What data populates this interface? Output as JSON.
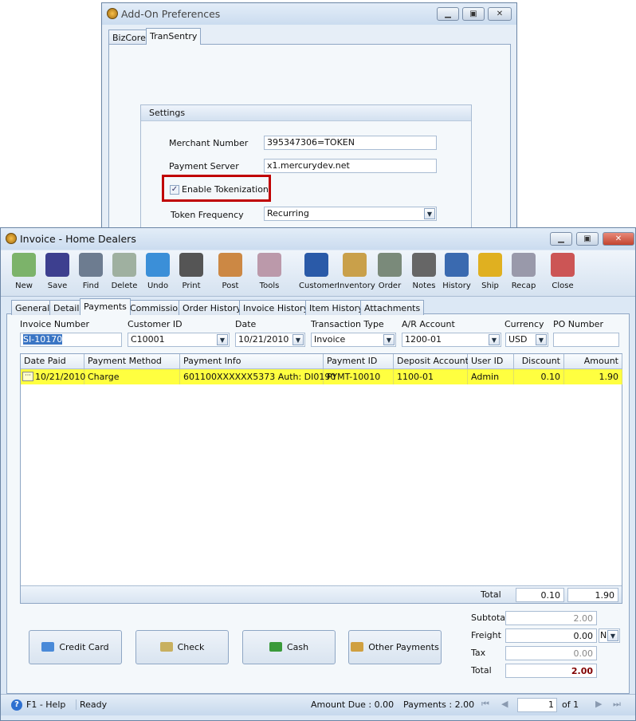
{
  "prefs": {
    "title": "Add-On Preferences",
    "tabs": [
      "BizCore",
      "TranSentry"
    ],
    "active_tab": "TranSentry",
    "group_title": "Settings",
    "merchant_label": "Merchant Number",
    "merchant_value": "395347306=TOKEN",
    "server_label": "Payment Server",
    "server_value": "x1.mercurydev.net",
    "tokenization_label": "Enable Tokenization",
    "tokenization_checked": true,
    "frequency_label": "Token Frequency",
    "frequency_value": "Recurring",
    "highlight_color": "#c00000"
  },
  "invoice": {
    "title": "Invoice - Home Dealers",
    "toolbar": [
      "New",
      "Save",
      "Find",
      "Delete",
      "Undo",
      "Print",
      "Post",
      "Tools",
      "Customer",
      "Inventory",
      "Order",
      "Notes",
      "History",
      "Ship",
      "Recap",
      "Close"
    ],
    "tabs": [
      "General",
      "Detail",
      "Payments",
      "Commission",
      "Order History",
      "Invoice History",
      "Item History",
      "Attachments"
    ],
    "active_tab": "Payments",
    "fields": {
      "invoice_number_label": "Invoice Number",
      "invoice_number": "SI-10170",
      "customer_label": "Customer ID",
      "customer": "C10001",
      "date_label": "Date",
      "date": "10/21/2010",
      "type_label": "Transaction Type",
      "type": "Invoice",
      "ar_label": "A/R Account",
      "ar": "1200-01",
      "currency_label": "Currency",
      "currency": "USD",
      "po_label": "PO Number",
      "po": ""
    },
    "grid": {
      "columns": [
        "Date Paid",
        "Payment Method",
        "Payment Info",
        "Payment ID",
        "Deposit Account",
        "User ID",
        "Discount",
        "Amount"
      ],
      "rows": [
        [
          "10/21/2010",
          "Charge",
          "601100XXXXXX5373 Auth: DI0190",
          "PYMT-10010",
          "1100-01",
          "Admin",
          "0.10",
          "1.90"
        ]
      ],
      "total_label": "Total",
      "total_discount": "0.10",
      "total_amount": "1.90",
      "row_highlight": "#ffff40"
    },
    "buttons": [
      "Credit Card",
      "Check",
      "Cash",
      "Other Payments"
    ],
    "totals": {
      "subtotal_label": "Subtotal",
      "subtotal": "2.00",
      "freight_label": "Freight",
      "freight": "0.00",
      "freight_option": "N",
      "tax_label": "Tax",
      "tax": "0.00",
      "total_label": "Total",
      "total": "2.00"
    },
    "status": {
      "help": "F1 - Help",
      "state": "Ready",
      "amount_due": "Amount Due : 0.00",
      "payments": "Payments : 2.00",
      "page": "1",
      "of": "of 1"
    }
  }
}
